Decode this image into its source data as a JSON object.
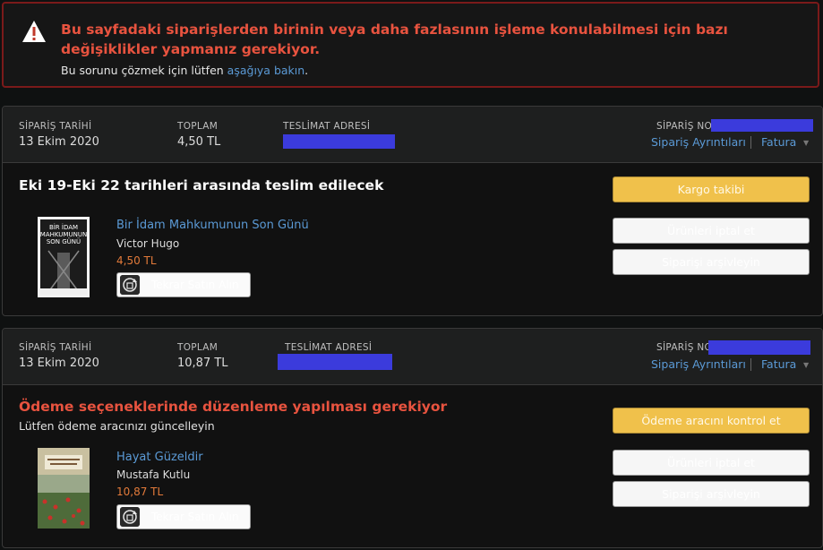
{
  "alert": {
    "title": "Bu sayfadaki siparişlerden birinin veya daha fazlasının işleme konulabilmesi için bazı değişiklikler yapmanız gerekiyor.",
    "sub_text": "Bu sorunu çözmek için lütfen ",
    "sub_link": "aşağıya bakın",
    "sub_end": "."
  },
  "labels": {
    "order_date": "SİPARİŞ TARİHİ",
    "total": "TOPLAM",
    "shipping_address": "TESLİMAT ADRESİ",
    "order_no": "SİPARİŞ NO",
    "order_details": "Sipariş Ayrıntıları",
    "invoice": "Fatura",
    "buy_again": "Tekrar Satın Alın",
    "cancel_items": "Ürünleri iptal et",
    "archive": "Siparişi arşivleyin"
  },
  "orders": [
    {
      "date": "13 Ekim 2020",
      "total": "4,50 TL",
      "status_title": "Eki 19-Eki 22 tarihleri arasında teslim edilecek",
      "status_sub": "",
      "primary_button": "Kargo takibi",
      "item": {
        "title": "Bir İdam Mahkumunun Son Günü",
        "author": "Victor Hugo",
        "price": "4,50 TL"
      }
    },
    {
      "date": "13 Ekim 2020",
      "total": "10,87 TL",
      "status_title": "Ödeme seçeneklerinde düzenleme yapılması gerekiyor",
      "status_sub": "Lütfen ödeme aracınızı güncelleyin",
      "primary_button": "Ödeme aracını kontrol et",
      "item": {
        "title": "Hayat Güzeldir",
        "author": "Mustafa Kutlu",
        "price": "10,87 TL"
      }
    }
  ],
  "covers": {
    "book1": "BİR İDAM MAHKUMUNUN SON GÜNÜ"
  },
  "colors": {
    "alert_red": "#e8533f",
    "link_blue": "#5b9ad6",
    "price_orange": "#e27a3a",
    "primary_button": "#f0c14b",
    "redaction": "#3b3bdc"
  },
  "icons": [
    "warning-icon",
    "buy-again-icon",
    "chevron-down-icon"
  ]
}
